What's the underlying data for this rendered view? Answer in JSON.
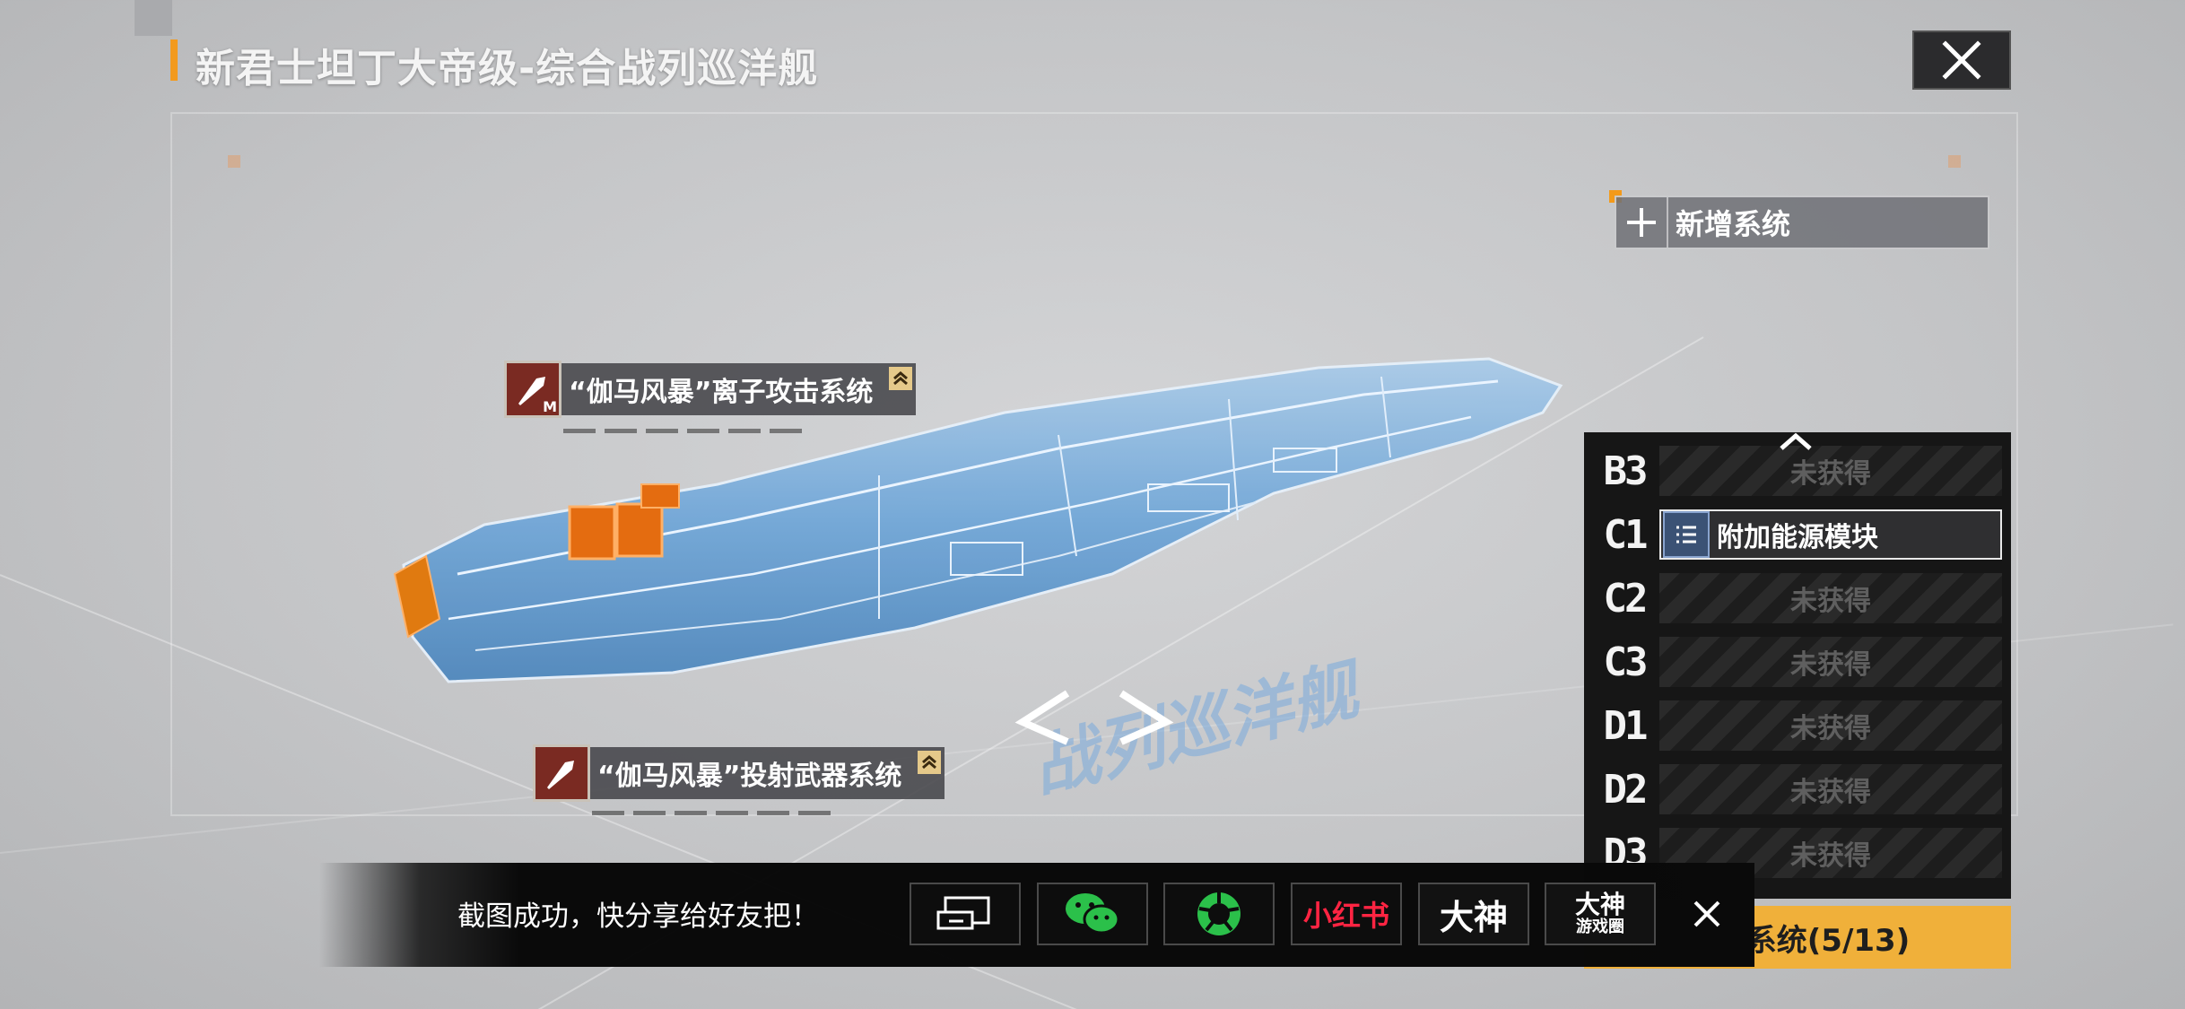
{
  "title": "新君士坦丁大帝级-综合战列巡洋舰",
  "add_system": {
    "label": "新增系统"
  },
  "callouts": [
    {
      "label": "“伽马风暴”离子攻击系统",
      "size_tag": "M"
    },
    {
      "label": "“伽马风暴”投射武器系统"
    }
  ],
  "slots": [
    {
      "code": "B3",
      "status": "未获得"
    },
    {
      "code": "C1",
      "status": "附加能源模块"
    },
    {
      "code": "C2",
      "status": "未获得"
    },
    {
      "code": "C3",
      "status": "未获得"
    },
    {
      "code": "D1",
      "status": "未获得"
    },
    {
      "code": "D2",
      "status": "未获得"
    },
    {
      "code": "D3",
      "status": "未获得"
    }
  ],
  "weapon_system": {
    "label": "武器系统(5/13)"
  },
  "share": {
    "message": "截图成功，快分享给好友把！",
    "xiaohongshu": "小红书",
    "dashen": "大神",
    "dashen_circle_top": "大神",
    "dashen_circle_bottom": "游戏圈"
  },
  "stage_text": "战列巡洋舰",
  "icons": {
    "close": "close-x-icon",
    "add": "plus-icon",
    "module": "list-icon",
    "chevron": "chevron-up-icon",
    "share_window": "window-share-icon",
    "wechat": "wechat-icon",
    "moments": "wechat-moments-icon"
  },
  "colors": {
    "accent_orange": "#f29a1e",
    "weapon_yellow": "#f0b03a",
    "ship_blue": "#6fa6d8",
    "wechat_green": "#2bc04a",
    "xiaohongshu_red": "#ff2442"
  }
}
